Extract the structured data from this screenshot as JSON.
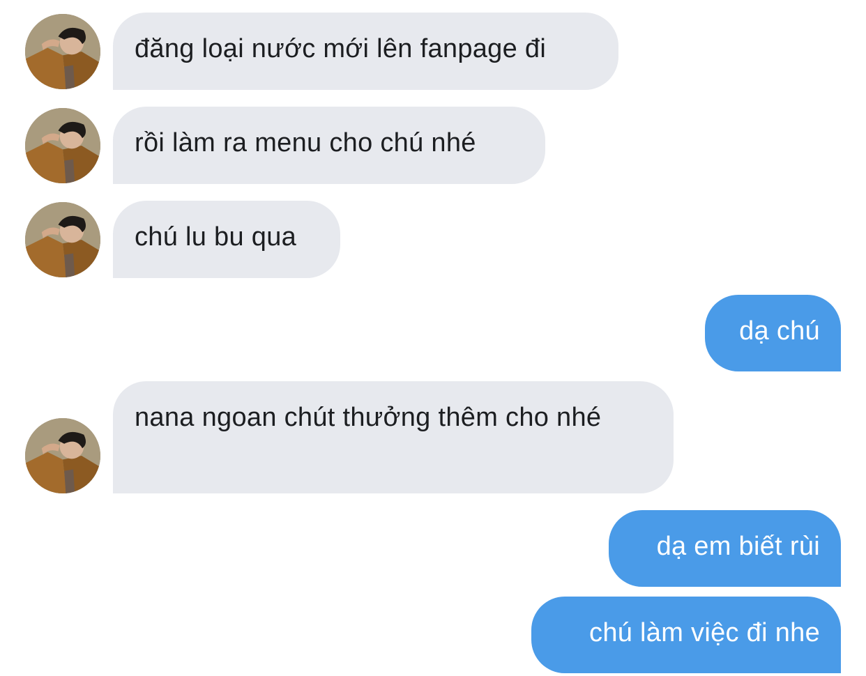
{
  "colors": {
    "incoming_bubble": "#e7e9ee",
    "outgoing_bubble": "#4a9be8",
    "incoming_text": "#1c1e21",
    "outgoing_text": "#ffffff"
  },
  "messages": [
    {
      "direction": "incoming",
      "text": "đăng loại nước mới lên fanpage đi",
      "has_avatar": true
    },
    {
      "direction": "incoming",
      "text": "rồi làm ra menu cho chú nhé",
      "has_avatar": true
    },
    {
      "direction": "incoming",
      "text": "chú lu bu qua",
      "has_avatar": true
    },
    {
      "direction": "outgoing",
      "text": "dạ chú"
    },
    {
      "direction": "incoming",
      "text": "nana ngoan chút thưởng thêm cho nhé",
      "has_avatar": true
    },
    {
      "direction": "outgoing",
      "text": "dạ em biết rùi"
    },
    {
      "direction": "outgoing",
      "text": "chú làm việc đi nhe"
    }
  ],
  "avatar_icon": "contact-photo-icon"
}
